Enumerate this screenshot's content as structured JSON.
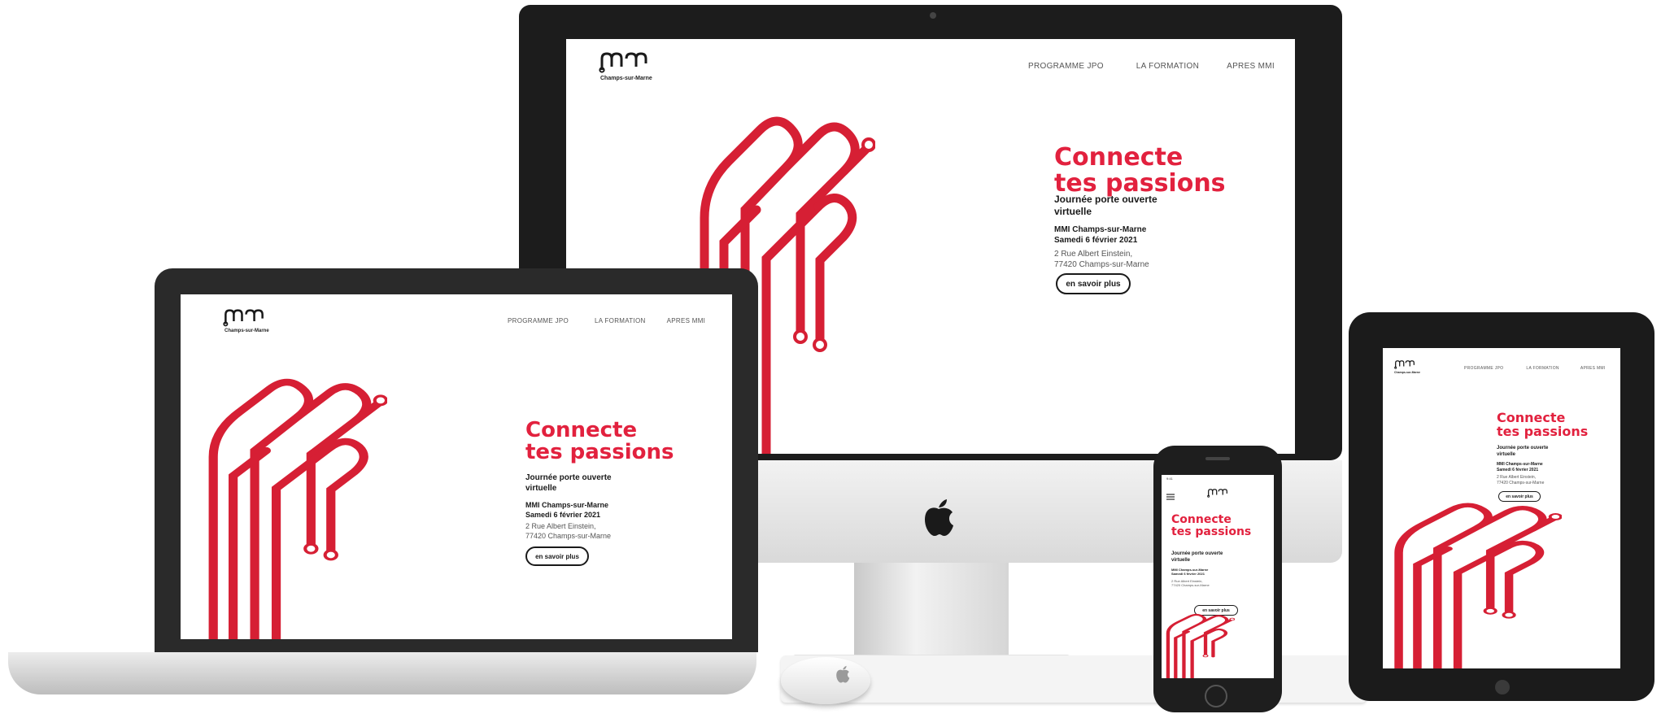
{
  "site": {
    "logo_text": "mmi",
    "logo_subtitle": "Champs-sur-Marne",
    "nav": [
      "PROGRAMME JPO",
      "LA FORMATION",
      "APRES MMI"
    ],
    "headline_line1": "Connecte",
    "headline_line2": "tes passions",
    "subtitle": "Journée porte ouverte virtuelle",
    "subtitle_line1": "Journée porte ouverte",
    "subtitle_line2": "virtuelle",
    "school": "MMI Champs-sur-Marne",
    "date": "Samedi 6 février 2021",
    "address_line1": "2 Rue Albert Einstein,",
    "address_line2": "77420 Champs-sur-Marne",
    "cta": "en savoir plus"
  },
  "phone_status": {
    "time": "9:41"
  },
  "colors": {
    "brand_red": "#e2213e",
    "dark_red": "#b0151f",
    "device_black": "#1c1c1c"
  },
  "icons": [
    "apple-logo-icon",
    "hamburger-menu-icon",
    "camera-icon"
  ]
}
